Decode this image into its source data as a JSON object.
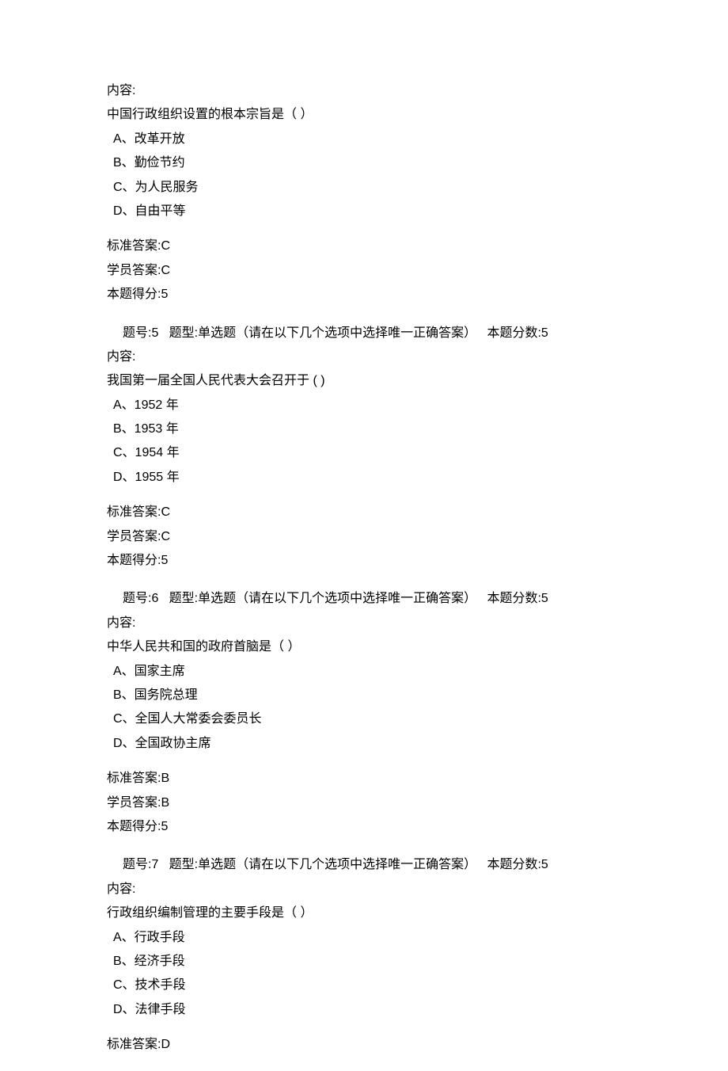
{
  "questions": [
    {
      "header": "",
      "content_label": "内容:",
      "stem": "中国行政组织设置的根本宗旨是（ ）",
      "options": [
        "A、改革开放",
        "B、勤俭节约",
        "C、为人民服务",
        "D、自由平等"
      ],
      "standard_answer_label": "标准答案:C",
      "student_answer_label": "学员答案:C",
      "score_label": "本题得分:5"
    },
    {
      "header": "题号:5   题型:单选题（请在以下几个选项中选择唯一正确答案）   本题分数:5",
      "content_label": "内容:",
      "stem": "我国第一届全国人民代表大会召开于  ( )",
      "options": [
        "A、1952 年",
        "B、1953 年",
        "C、1954 年",
        "D、1955 年"
      ],
      "standard_answer_label": "标准答案:C",
      "student_answer_label": "学员答案:C",
      "score_label": "本题得分:5"
    },
    {
      "header": "题号:6   题型:单选题（请在以下几个选项中选择唯一正确答案）   本题分数:5",
      "content_label": "内容:",
      "stem": "中华人民共和国的政府首脑是（ ）",
      "options": [
        "A、国家主席",
        "B、国务院总理",
        "C、全国人大常委会委员长",
        "D、全国政协主席"
      ],
      "standard_answer_label": "标准答案:B",
      "student_answer_label": "学员答案:B",
      "score_label": "本题得分:5"
    },
    {
      "header": "题号:7   题型:单选题（请在以下几个选项中选择唯一正确答案）   本题分数:5",
      "content_label": "内容:",
      "stem": "行政组织编制管理的主要手段是（ ）",
      "options": [
        "A、行政手段",
        "B、经济手段",
        "C、技术手段",
        "D、法律手段"
      ],
      "standard_answer_label": "标准答案:D",
      "student_answer_label": "",
      "score_label": ""
    }
  ]
}
